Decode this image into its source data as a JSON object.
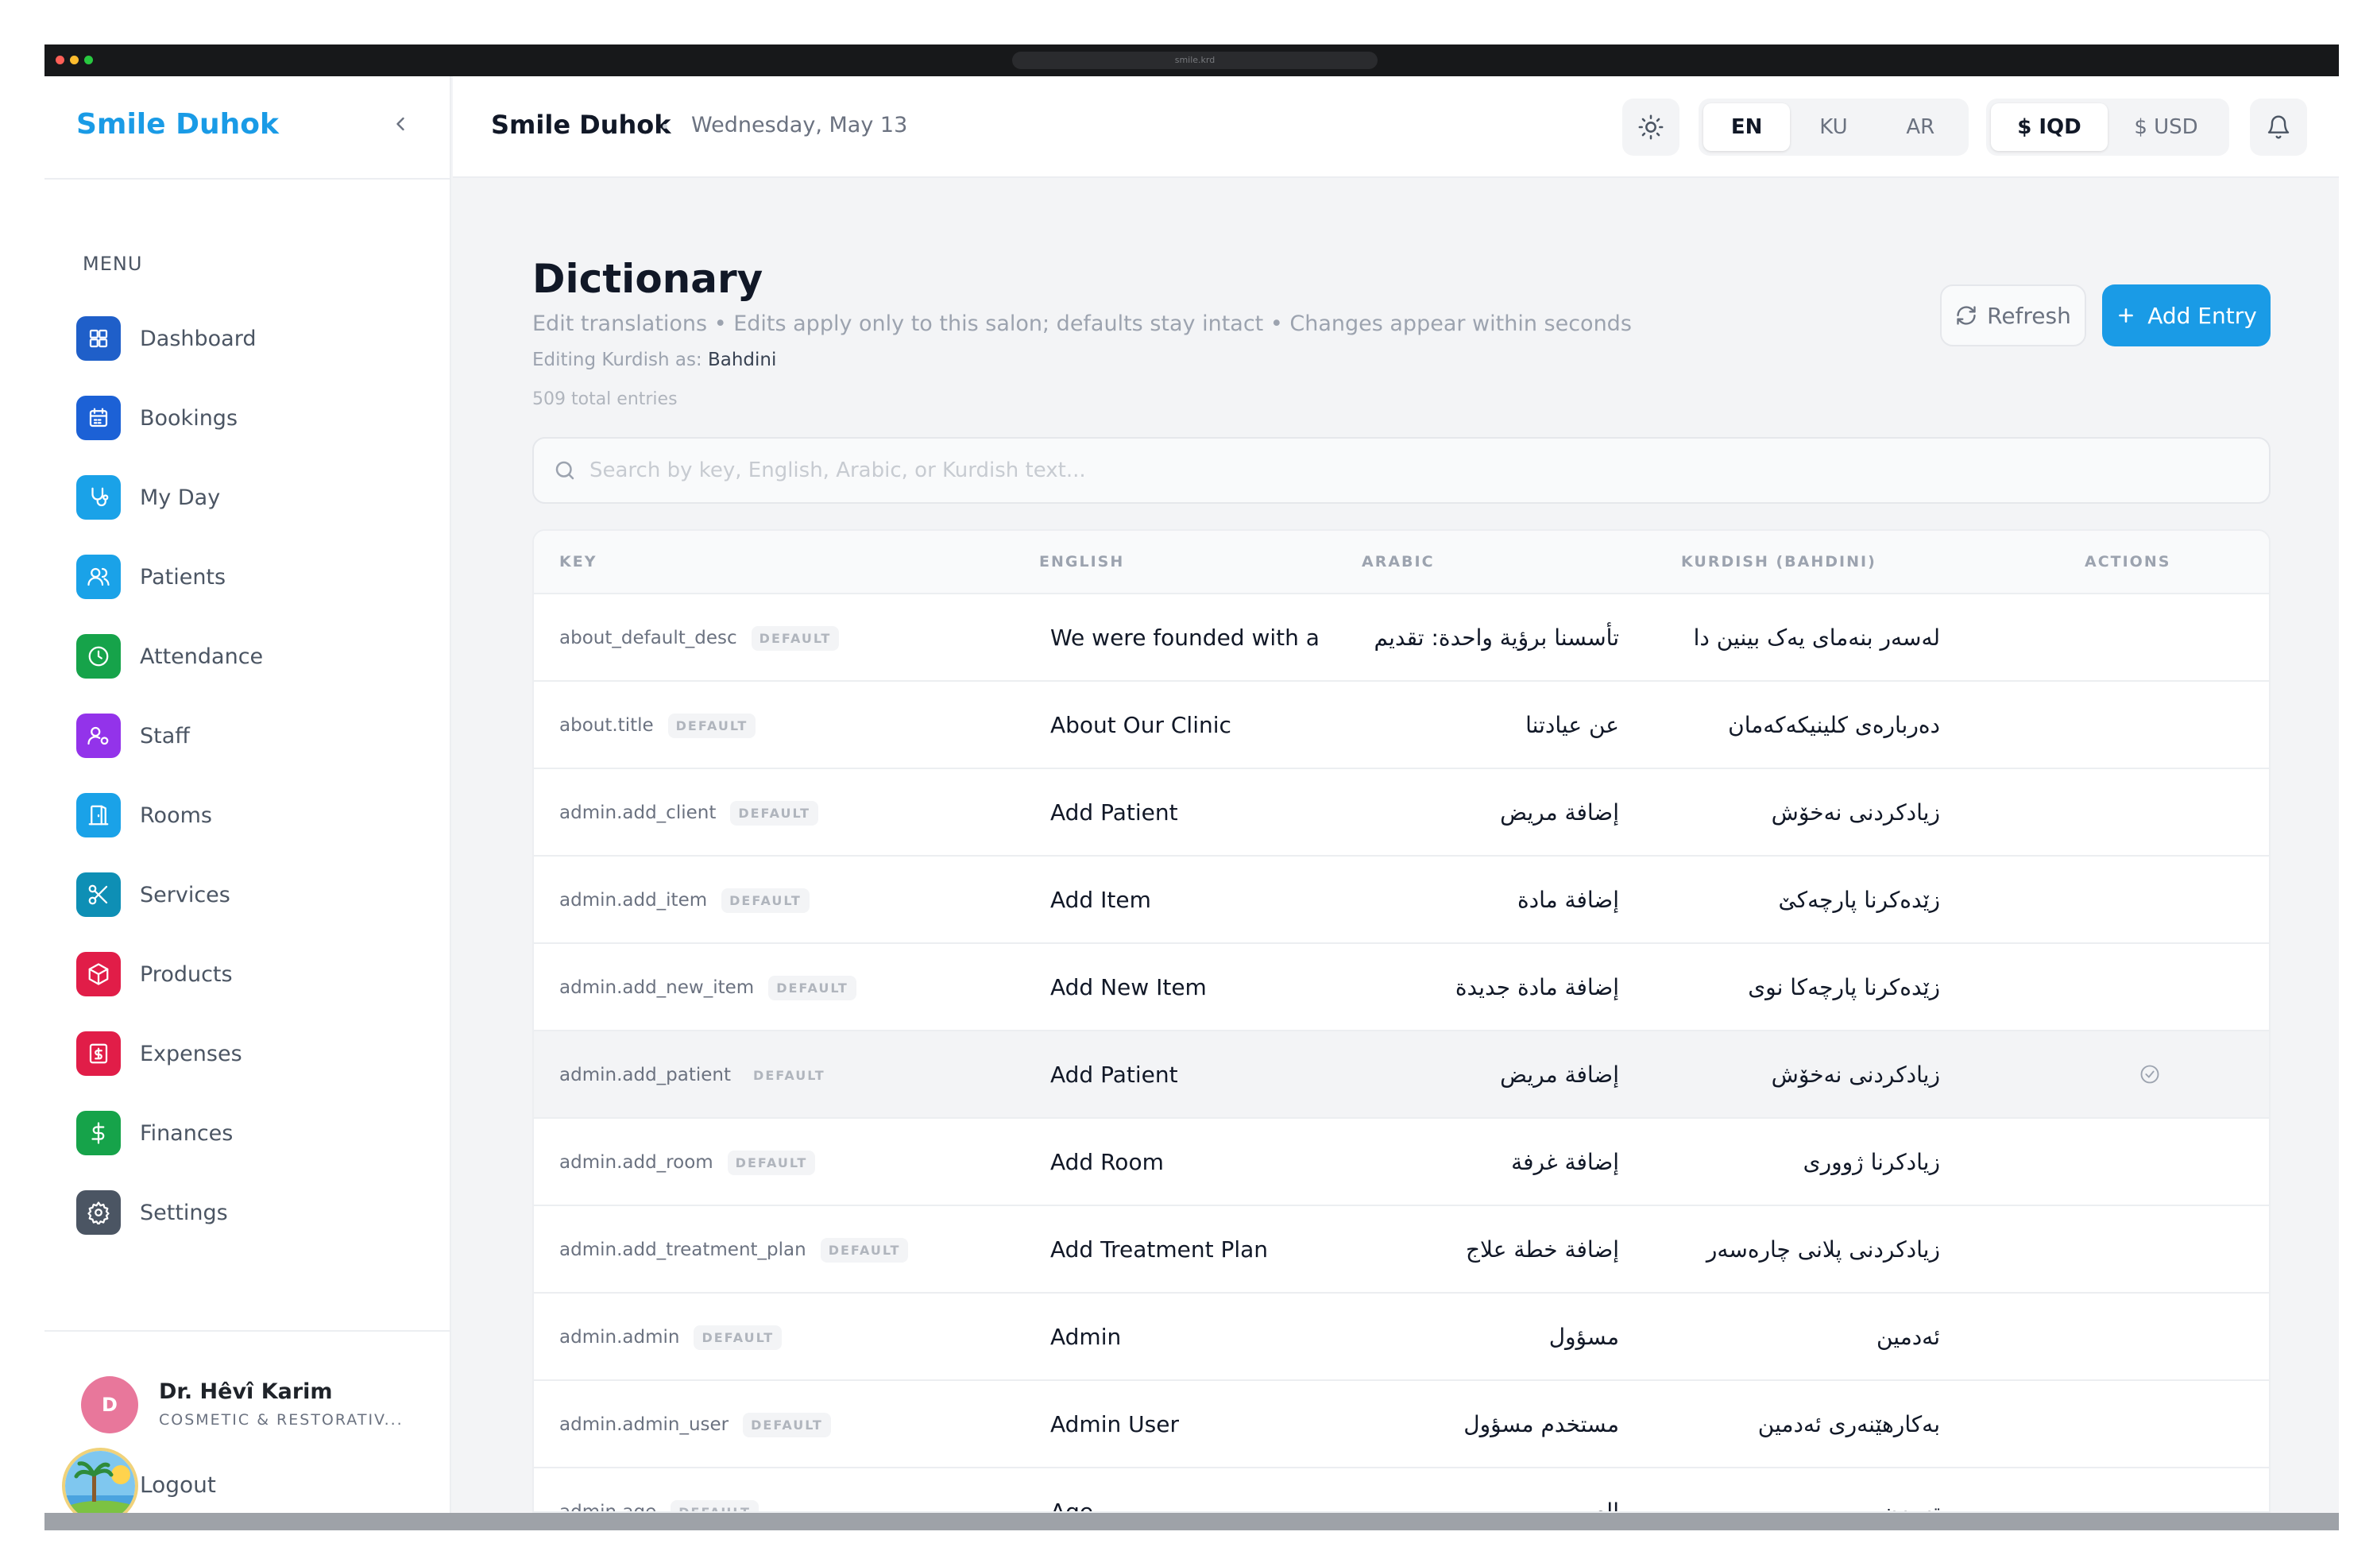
{
  "window": {
    "url": "smile.krd"
  },
  "sidebar": {
    "brand": "Smile Duhok",
    "menu_title": "MENU",
    "items": [
      {
        "label": "Dashboard",
        "icon": "grid-icon",
        "color": "#1f5fc9"
      },
      {
        "label": "Bookings",
        "icon": "calendar-icon",
        "color": "#1c61d6"
      },
      {
        "label": "My Day",
        "icon": "stethoscope-icon",
        "color": "#1aa2e8"
      },
      {
        "label": "Patients",
        "icon": "users-icon",
        "color": "#1aa2e8"
      },
      {
        "label": "Attendance",
        "icon": "clock-icon",
        "color": "#16a34a"
      },
      {
        "label": "Staff",
        "icon": "user-cog-icon",
        "color": "#9333ea"
      },
      {
        "label": "Rooms",
        "icon": "door-icon",
        "color": "#1aa2e8"
      },
      {
        "label": "Services",
        "icon": "scissors-icon",
        "color": "#0e8fb5"
      },
      {
        "label": "Products",
        "icon": "box-icon",
        "color": "#e11d48"
      },
      {
        "label": "Expenses",
        "icon": "receipt-icon",
        "color": "#e11d48"
      },
      {
        "label": "Finances",
        "icon": "dollar-icon",
        "color": "#16a34a"
      },
      {
        "label": "Settings",
        "icon": "gear-icon",
        "color": "#4b5563"
      }
    ],
    "user": {
      "initial": "D",
      "name": "Dr. Hêvî Karim",
      "role": "COSMETIC & RESTORATIV..."
    },
    "logout": "Logout"
  },
  "header": {
    "title": "Smile Duhok",
    "date": "Wednesday, May 13",
    "languages": [
      "EN",
      "KU",
      "AR"
    ],
    "active_language": "EN",
    "currencies": [
      "$ IQD",
      "$ USD"
    ],
    "active_currency": "$ IQD"
  },
  "page": {
    "title": "Dictionary",
    "subtitle": "Edit translations • Edits apply only to this salon; defaults stay intact • Changes appear within seconds",
    "editing_prefix": "Editing Kurdish as:",
    "editing_dialect": "Bahdini",
    "total": "509 total entries",
    "refresh": "Refresh",
    "add": "Add Entry",
    "search_placeholder": "Search by key, English, Arabic, or Kurdish text..."
  },
  "table": {
    "columns": [
      "KEY",
      "ENGLISH",
      "ARABIC",
      "KURDISH (BAHDINI)",
      "ACTIONS"
    ],
    "default_badge": "DEFAULT",
    "rows": [
      {
        "key": "about_default_desc",
        "en": "We were founded with a",
        "ar": "تأسسنا برؤية واحدة: تقديم",
        "ku": "لەسەر بنەمای یەک بینین دا"
      },
      {
        "key": "about.title",
        "en": "About Our Clinic",
        "ar": "عن عيادتنا",
        "ku": "دەربارەی کلینیکەکەمان"
      },
      {
        "key": "admin.add_client",
        "en": "Add Patient",
        "ar": "إضافة مريض",
        "ku": "زیادکردنی نەخۆش"
      },
      {
        "key": "admin.add_item",
        "en": "Add Item",
        "ar": "إضافة مادة",
        "ku": "زێدەکرنا پارچەکێ"
      },
      {
        "key": "admin.add_new_item",
        "en": "Add New Item",
        "ar": "إضافة مادة جديدة",
        "ku": "زێدەکرنا پارچەکا نوی"
      },
      {
        "key": "admin.add_patient",
        "en": "Add Patient",
        "ar": "إضافة مريض",
        "ku": "زیادکردنی نەخۆش",
        "hover": true
      },
      {
        "key": "admin.add_room",
        "en": "Add Room",
        "ar": "إضافة غرفة",
        "ku": "زیادکرنا ژووری"
      },
      {
        "key": "admin.add_treatment_plan",
        "en": "Add Treatment Plan",
        "ar": "إضافة خطة علاج",
        "ku": "زیادکردنی پلانی چارەسەر"
      },
      {
        "key": "admin.admin",
        "en": "Admin",
        "ar": "مسؤول",
        "ku": "ئەدمین"
      },
      {
        "key": "admin.admin_user",
        "en": "Admin User",
        "ar": "مستخدم مسؤول",
        "ku": "بەکارهێنەری ئەدمین"
      },
      {
        "key": "admin.age",
        "en": "Age",
        "ar": "العمر",
        "ku": "تەمەن"
      }
    ]
  }
}
